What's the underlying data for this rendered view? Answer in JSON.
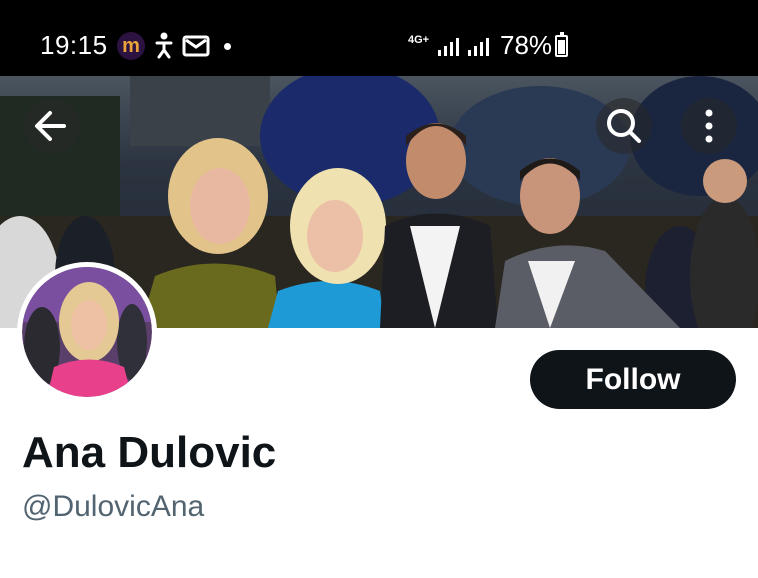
{
  "status_bar": {
    "time": "19:15",
    "app_icon_letter": "m",
    "network": "4G+",
    "battery": "78%",
    "battery_level": 0.78
  },
  "banner": {
    "description_colors": [
      "#4b5560",
      "#1d2530"
    ]
  },
  "profile": {
    "name": "Ana Dulovic",
    "handle": "@DulovicAna",
    "follow_label": "Follow"
  },
  "icons": [
    "back-arrow-icon",
    "search-icon",
    "more-vertical-icon"
  ]
}
